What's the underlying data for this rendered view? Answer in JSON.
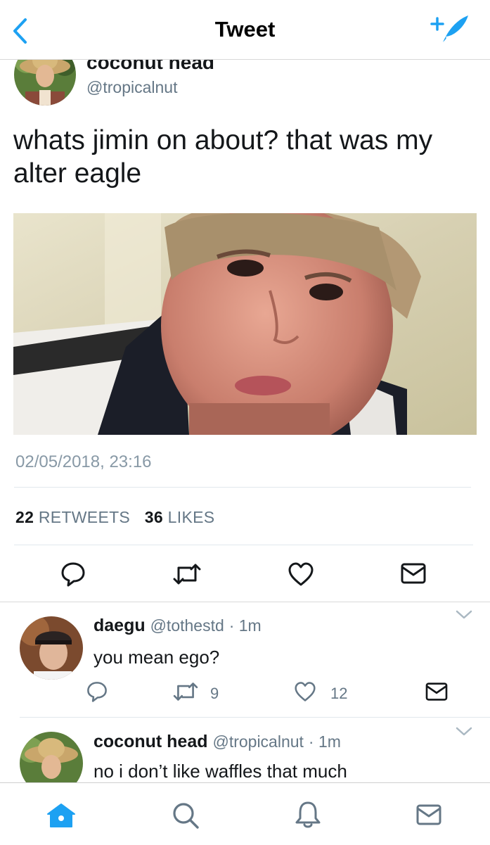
{
  "header": {
    "title": "Tweet"
  },
  "tweet": {
    "author_name": "coconut head",
    "author_handle": "@tropicalnut",
    "text": "whats jimin on about? that was my alter eagle",
    "timestamp": "02/05/2018, 23:16",
    "retweet_count": "22",
    "retweet_label": "RETWEETS",
    "like_count": "36",
    "like_label": "LIKES"
  },
  "replies": [
    {
      "name": "daegu",
      "handle": "@tothestd",
      "time": "· 1m",
      "text": "you mean ego?",
      "retweets": "9",
      "likes": "12"
    },
    {
      "name": "coconut head",
      "handle": "@tropicalnut",
      "time": "· 1m",
      "text": "no i don’t like waffles that much"
    }
  ],
  "colors": {
    "accent": "#1da1f2",
    "icon_gray": "#657786",
    "divider": "#e1e8ed"
  },
  "icons": [
    "back-chevron-icon",
    "compose-icon",
    "reply-icon",
    "retweet-icon",
    "like-icon",
    "message-icon",
    "home-icon",
    "search-icon",
    "notifications-icon",
    "chevron-down-icon"
  ]
}
